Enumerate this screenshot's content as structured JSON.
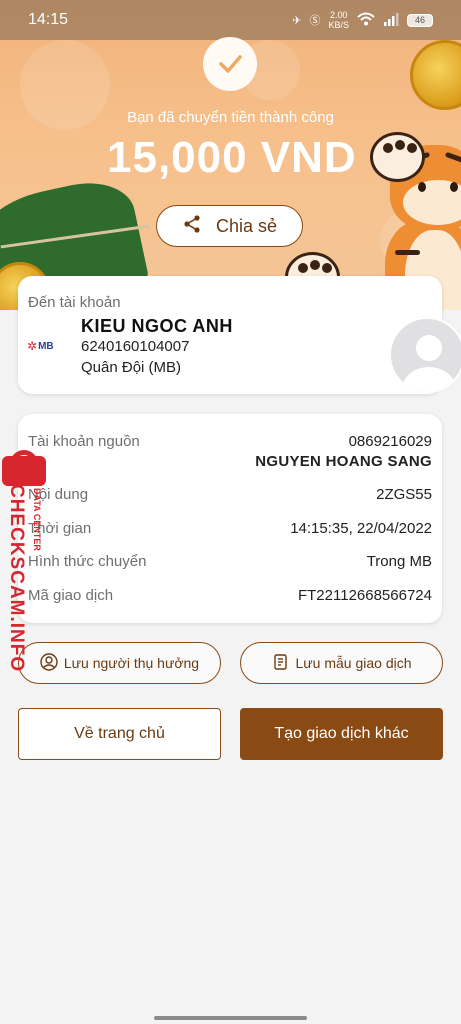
{
  "status_bar": {
    "time": "14:15",
    "net_speed_value": "2.00",
    "net_speed_unit": "KB/S",
    "battery": "46"
  },
  "success": {
    "message": "Bạn đã chuyển tiền thành công",
    "amount": "15,000 VND",
    "share_label": "Chia sẻ"
  },
  "destination": {
    "label": "Đến tài khoản",
    "bank_logo": "MB",
    "name": "KIEU NGOC ANH",
    "account": "6240160104007",
    "bank": "Quân Đội (MB)"
  },
  "details": {
    "source_label": "Tài khoản nguồn",
    "source_account": "0869216029",
    "source_name": "NGUYEN HOANG SANG",
    "content_label": "Nội dung",
    "content_value": "2ZGS55",
    "time_label": "Thời gian",
    "time_value": "14:15:35, 22/04/2022",
    "method_label": "Hình thức chuyển",
    "method_value": "Trong MB",
    "txn_label": "Mã giao dịch",
    "txn_value": "FT22112668566724"
  },
  "actions": {
    "save_beneficiary": "Lưu người thụ hưởng",
    "save_template": "Lưu mẫu giao dịch",
    "home": "Về trang chủ",
    "new_transaction": "Tạo giao dịch khác"
  },
  "watermark": {
    "main": "CHECKSCAM.INFO",
    "sub": "DATA CENTER"
  },
  "colors": {
    "brand": "#8a4a14",
    "hero": "#f5c08c",
    "watermark": "#d7262e"
  }
}
